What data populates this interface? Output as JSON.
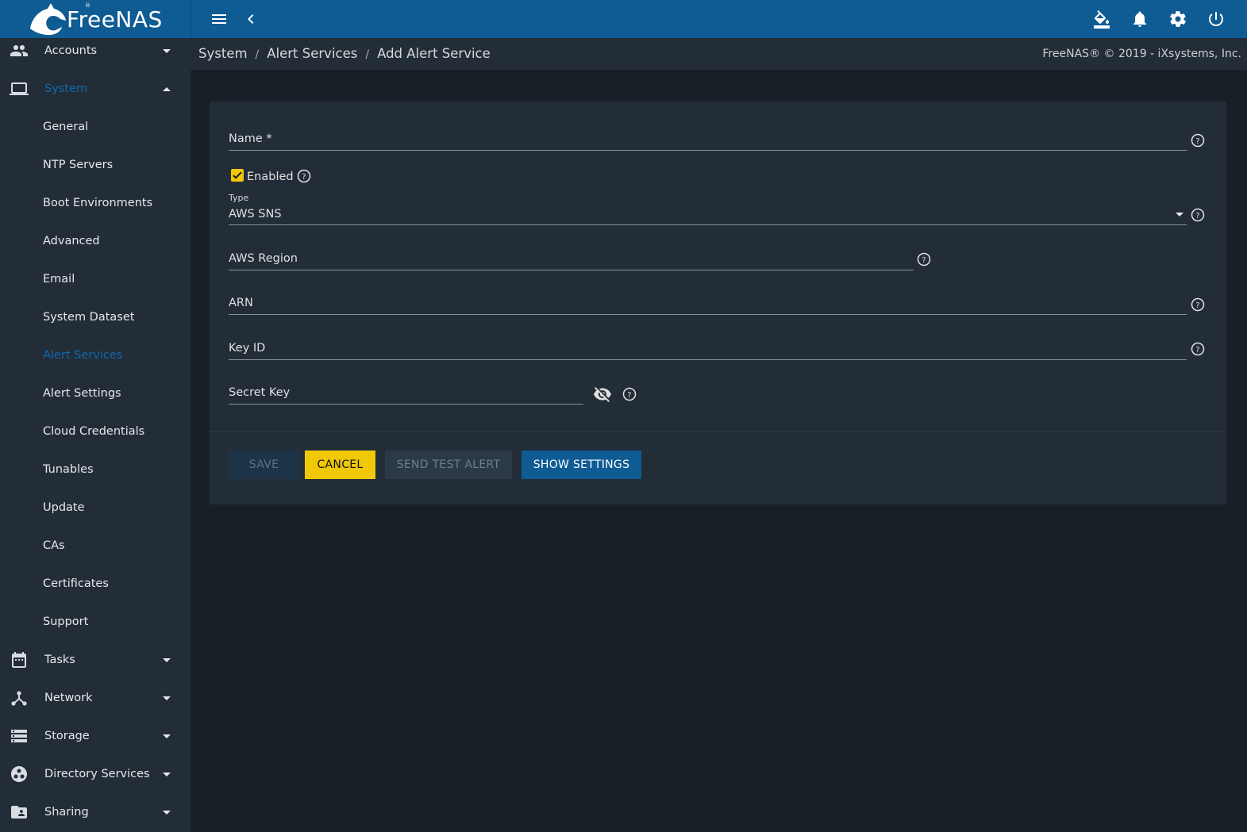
{
  "app": {
    "brand": "FreeNAS",
    "brand_sup": "®"
  },
  "topbar": {
    "menu_icon": "hamburger-menu-icon",
    "back_icon": "chevron-left-icon",
    "theme_icon": "paint-bucket-icon",
    "alerts_icon": "bell-icon",
    "settings_icon": "gear-icon",
    "power_icon": "power-icon"
  },
  "sidebar": {
    "items": [
      {
        "label": "Accounts",
        "icon": "people-icon"
      },
      {
        "label": "System",
        "icon": "laptop-icon",
        "expanded": true
      },
      {
        "label": "Tasks",
        "icon": "calendar-icon"
      },
      {
        "label": "Network",
        "icon": "network-icon"
      },
      {
        "label": "Storage",
        "icon": "storage-icon"
      },
      {
        "label": "Directory Services",
        "icon": "directory-services-icon"
      },
      {
        "label": "Sharing",
        "icon": "shared-folder-icon"
      }
    ],
    "system_children": [
      {
        "label": "General"
      },
      {
        "label": "NTP Servers"
      },
      {
        "label": "Boot Environments"
      },
      {
        "label": "Advanced"
      },
      {
        "label": "Email"
      },
      {
        "label": "System Dataset"
      },
      {
        "label": "Alert Services",
        "active": true
      },
      {
        "label": "Alert Settings"
      },
      {
        "label": "Cloud Credentials"
      },
      {
        "label": "Tunables"
      },
      {
        "label": "Update"
      },
      {
        "label": "CAs"
      },
      {
        "label": "Certificates"
      },
      {
        "label": "Support"
      }
    ]
  },
  "breadcrumb": {
    "items": [
      "System",
      "Alert Services",
      "Add Alert Service"
    ],
    "separator": "/"
  },
  "copyright": "FreeNAS® © 2019 - iXsystems, Inc.",
  "form": {
    "name": {
      "label": "Name *",
      "value": ""
    },
    "enabled": {
      "label": "Enabled",
      "checked": true
    },
    "type": {
      "label": "Type",
      "value": "AWS SNS"
    },
    "aws_region": {
      "label": "AWS Region",
      "value": ""
    },
    "arn": {
      "label": "ARN",
      "value": ""
    },
    "key_id": {
      "label": "Key ID",
      "value": ""
    },
    "secret_key": {
      "label": "Secret Key",
      "value": "",
      "visibility_icon": "eye-off-icon"
    }
  },
  "buttons": {
    "save": "SAVE",
    "cancel": "CANCEL",
    "send_test_alert": "SEND TEST ALERT",
    "show_settings": "SHOW SETTINGS"
  },
  "colors": {
    "topbar": "#0f5b94",
    "sidebar": "#232d38",
    "background": "#191f27",
    "accent_yellow": "#f0c808",
    "active_link": "#0f69ad"
  }
}
